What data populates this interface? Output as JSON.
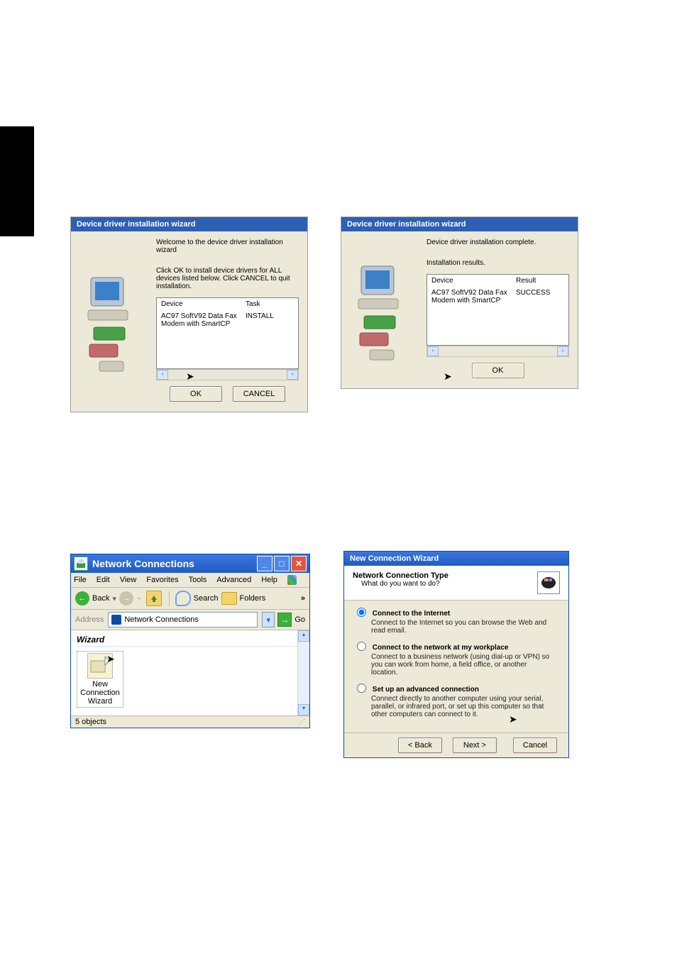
{
  "leftTab": true,
  "installer1": {
    "title": "Device driver installation wizard",
    "line1": "Welcome to the device driver installation wizard",
    "line2": "Click OK to install device drivers for ALL devices listed below. Click CANCEL to quit installation.",
    "col1": "Device",
    "col2": "Task",
    "device": "AC97 SoftV92 Data Fax Modem with SmartCP",
    "task": "INSTALL",
    "ok": "OK",
    "cancel": "CANCEL"
  },
  "installer2": {
    "title": "Device driver installation wizard",
    "line1": "Device driver installation complete.",
    "line2": "Installation results.",
    "col1": "Device",
    "col2": "Result",
    "device": "AC97 SoftV92 Data Fax Modem with SmartCP",
    "task": "SUCCESS",
    "ok": "OK"
  },
  "explorer": {
    "title": "Network Connections",
    "menu": {
      "file": "File",
      "edit": "Edit",
      "view": "View",
      "fav": "Favorites",
      "tools": "Tools",
      "adv": "Advanced",
      "help": "Help"
    },
    "toolbar": {
      "back": "Back",
      "search": "Search",
      "folders": "Folders",
      "chev": "»"
    },
    "addrLabel": "Address",
    "addrValue": "Network Connections",
    "go": "Go",
    "category": "Wizard",
    "item": {
      "l1": "New",
      "l2": "Connection",
      "l3": "Wizard"
    },
    "status": "5 objects"
  },
  "ncw": {
    "title": "New Connection Wizard",
    "headTitle": "Network Connection Type",
    "headSub": "What do you want to do?",
    "opt1": {
      "t": "Connect to the Internet",
      "d": "Connect to the Internet so you can browse the Web and read email."
    },
    "opt2": {
      "t": "Connect to the network at my workplace",
      "d": "Connect to a business network (using dial-up or VPN) so you can work from home, a field office, or another location."
    },
    "opt3": {
      "t": "Set up an advanced connection",
      "d": "Connect directly to another computer using your serial, parallel, or infrared port, or set up this computer so that other computers can connect to it."
    },
    "back": "< Back",
    "next": "Next >",
    "cancel": "Cancel"
  }
}
